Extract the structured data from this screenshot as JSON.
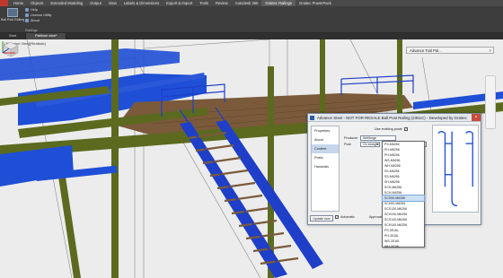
{
  "ribbon": {
    "tabs": [
      "Home",
      "Objects",
      "Extended Modeling",
      "Output",
      "View",
      "Labels & Dimensions",
      "Export & Import",
      "Tools",
      "Review",
      "Autodesk 360",
      "Graitec Railings",
      "Graitec PowerPack"
    ],
    "active_tab": "Graitec Railings",
    "big_button": "Ball Post Railing",
    "small_buttons": [
      "Help",
      "License Utility",
      "About"
    ],
    "group_label": "Railings"
  },
  "document_tabs": [
    "Start",
    "Platform view*"
  ],
  "viewport": {
    "view_label": "[-][Custom View][Realistic]"
  },
  "palette": {
    "title": "Advance Tool Pal..."
  },
  "dialog": {
    "title": "Advance Steel - NOT FOR RESALE   Ball Post Railing (2351C) - Developed by Graitec",
    "nav": [
      "Properties",
      "About",
      "Content",
      "Posts",
      "Handrails"
    ],
    "nav_selected": "Content",
    "use_existing_posts_label": "Use existing posts",
    "producer_label": "Producer",
    "producer_value": "Wellforge",
    "post_label": "Post",
    "post_type_value": "On straight",
    "post_value": "PS-M6256",
    "dropdown_items": [
      "PS-M6256",
      "PH-M6256",
      "PH-M6256",
      "WS-M6256",
      "WH-M6256",
      "SS-M6256",
      "SS-M6256",
      "SH-M6256",
      "SCS-M6256",
      "SCH-M6256",
      "SCS90-M6256",
      "SCH90-M6256",
      "SCS130-M6256",
      "SCH130-M6256",
      "SCS140-M6256",
      "SCH140-M6256",
      "PS-3S16L",
      "PH-3S16L",
      "WS-3S16L",
      "WH-3S16L",
      "SS-3S16L"
    ],
    "dropdown_highlight": "SCH90-M6256",
    "update_button": "Update now",
    "automatic_label": "Automatic",
    "approval_label": "Approval sta",
    "close_glyph": "×"
  },
  "colors": {
    "beam": "#5b6a1f",
    "stair": "#1f4fd6",
    "deck": "#7a5a3a",
    "rail": "#1f3fc8"
  }
}
